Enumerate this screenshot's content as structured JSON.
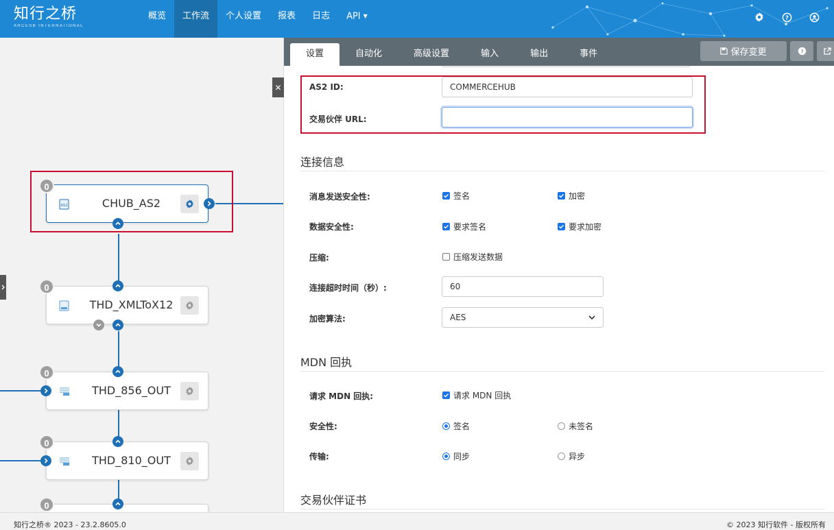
{
  "brand": {
    "name": "知行之桥",
    "tagline": "ARCESB INTERNATIONAL"
  },
  "nav": {
    "items": [
      {
        "label": "概览",
        "active": false
      },
      {
        "label": "工作流",
        "active": true
      },
      {
        "label": "个人设置",
        "active": false
      },
      {
        "label": "报表",
        "active": false
      },
      {
        "label": "日志",
        "active": false
      },
      {
        "label": "API",
        "active": false,
        "dropdown": true
      }
    ],
    "icons": [
      "gear-icon",
      "help-icon",
      "user-icon"
    ]
  },
  "workflow": {
    "nodes": [
      {
        "name": "CHUB_AS2",
        "count": "0",
        "icon": "as2-icon",
        "selected": true
      },
      {
        "name": "THD_XMLToX12",
        "count": "0",
        "icon": "x12-icon",
        "selected": false
      },
      {
        "name": "THD_856_OUT",
        "count": "0",
        "icon": "xml-icon",
        "selected": false
      },
      {
        "name": "THD_810_OUT",
        "count": "0",
        "icon": "xml-icon",
        "selected": false
      },
      {
        "name": "",
        "count": "0",
        "icon": "",
        "selected": false
      }
    ]
  },
  "panel": {
    "tabs": [
      {
        "label": "设置",
        "active": true
      },
      {
        "label": "自动化",
        "active": false
      },
      {
        "label": "高级设置",
        "active": false
      },
      {
        "label": "输入",
        "active": false
      },
      {
        "label": "输出",
        "active": false
      },
      {
        "label": "事件",
        "active": false
      }
    ],
    "save_label": "保存变更",
    "partner": {
      "as2_id_label": "AS2 ID:",
      "as2_id_value": "COMMERCEHUB",
      "url_label": "交易伙伴 URL:",
      "url_value": ""
    },
    "connection": {
      "title": "连接信息",
      "msg_security_label": "消息发送安全性:",
      "sign_label": "签名",
      "sign_checked": true,
      "encrypt_label": "加密",
      "encrypt_checked": true,
      "data_security_label": "数据安全性:",
      "require_sign_label": "要求签名",
      "require_sign_checked": true,
      "require_encrypt_label": "要求加密",
      "require_encrypt_checked": true,
      "compression_label": "压缩:",
      "compress_option_label": "压缩发送数据",
      "compress_checked": false,
      "timeout_label": "连接超时时间（秒）:",
      "timeout_value": "60",
      "algorithm_label": "加密算法:",
      "algorithm_value": "AES"
    },
    "mdn": {
      "title": "MDN 回执",
      "request_label": "请求 MDN 回执:",
      "request_option_label": "请求 MDN 回执",
      "request_checked": true,
      "security_label": "安全性:",
      "signed_label": "签名",
      "unsigned_label": "未签名",
      "security_value": "签名",
      "delivery_label": "传输:",
      "sync_label": "同步",
      "async_label": "异步",
      "delivery_value": "同步"
    },
    "certs": {
      "title": "交易伙伴证书"
    }
  },
  "footer": {
    "version": "知行之桥® 2023 - 23.2.8605.0",
    "copyright": "© 2023 知行软件 - 版权所有"
  }
}
